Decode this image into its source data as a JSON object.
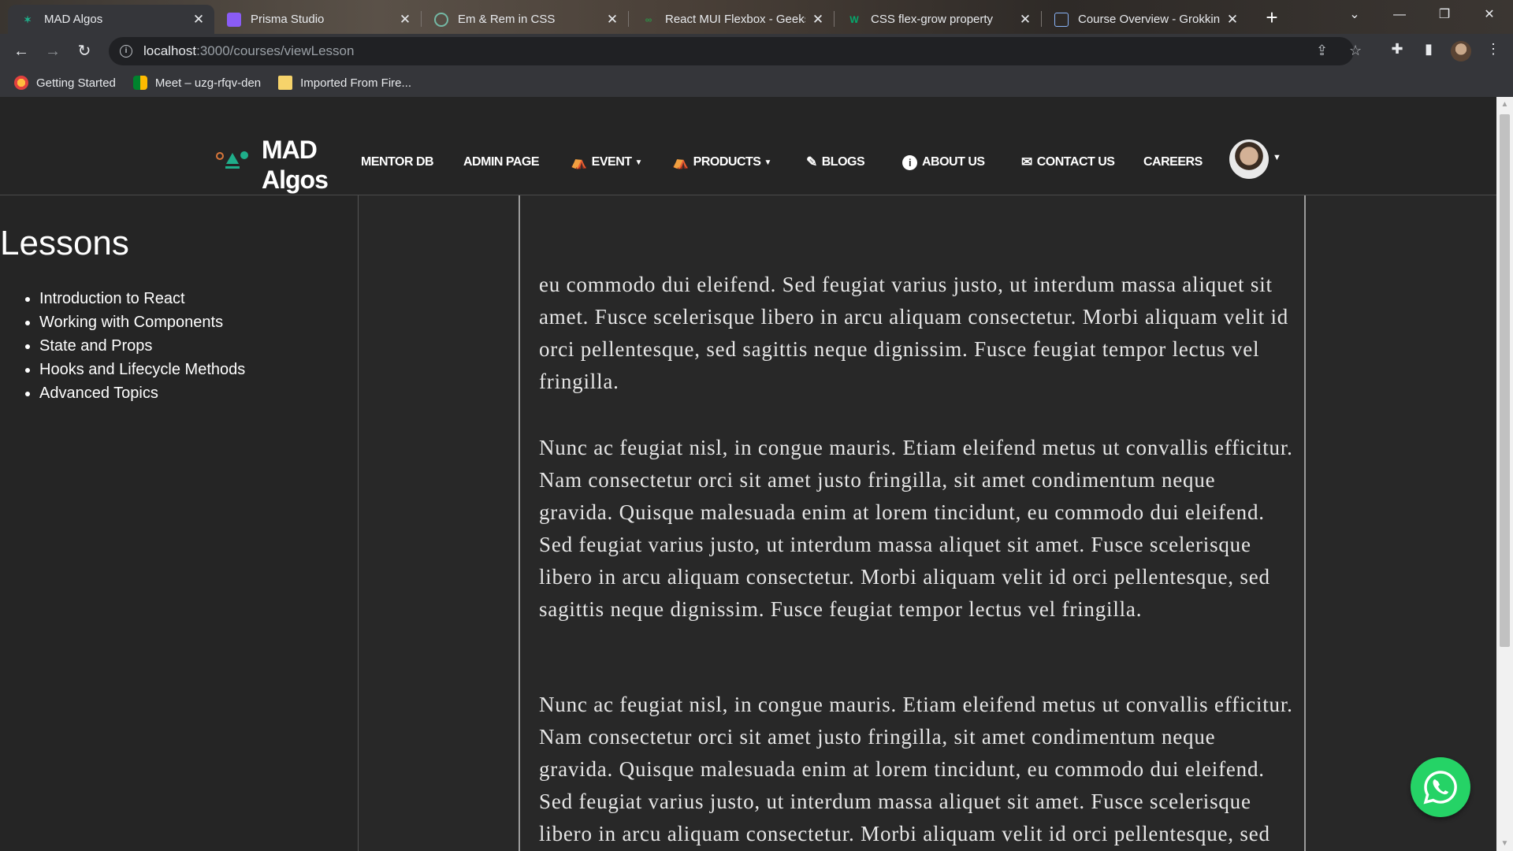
{
  "browser": {
    "tabs": [
      {
        "title": "MAD Algos",
        "active": true
      },
      {
        "title": "Prisma Studio",
        "active": false
      },
      {
        "title": "Em & Rem in CSS",
        "active": false
      },
      {
        "title": "React MUI Flexbox - Geeksf",
        "active": false
      },
      {
        "title": "CSS flex-grow property",
        "active": false
      },
      {
        "title": "Course Overview - Grokkinc",
        "active": false
      }
    ],
    "url_host": "localhost",
    "url_path": ":3000/courses/viewLesson",
    "bookmarks": [
      {
        "label": "Getting Started",
        "icon": "firefox-icon"
      },
      {
        "label": "Meet – uzg-rfqv-den",
        "icon": "meet-icon"
      },
      {
        "label": "Imported From Fire...",
        "icon": "folder-icon"
      }
    ]
  },
  "site": {
    "logo_line1": "MAD",
    "logo_line2": "Algos",
    "nav": [
      {
        "label": "MENTOR DB"
      },
      {
        "label": "ADMIN PAGE"
      },
      {
        "label": "EVENT",
        "icon": "event-icon",
        "dropdown": true
      },
      {
        "label": "PRODUCTS",
        "icon": "products-icon",
        "dropdown": true
      },
      {
        "label": "BLOGS",
        "icon": "edit-icon"
      },
      {
        "label": "ABOUT US",
        "icon": "info-icon"
      },
      {
        "label": "CONTACT US",
        "icon": "mail-icon"
      },
      {
        "label": "CAREERS"
      }
    ]
  },
  "sidebar": {
    "title": "Lessons",
    "lessons": [
      "Introduction to React",
      "Working with Components",
      "State and Props",
      "Hooks and Lifecycle Methods",
      "Advanced Topics"
    ]
  },
  "lesson": {
    "partial_paragraph": "eu commodo dui eleifend. Sed feugiat varius justo, ut interdum massa aliquet sit amet. Fusce scelerisque libero in arcu aliquam consectetur. Morbi aliquam velit id orci pellentesque, sed sagittis neque dignissim. Fusce feugiat tempor lectus vel fringilla.",
    "paragraphs": [
      "Nunc ac feugiat nisl, in congue mauris. Etiam eleifend metus ut convallis efficitur. Nam consectetur orci sit amet justo fringilla, sit amet condimentum neque gravida. Quisque malesuada enim at lorem tincidunt, eu commodo dui eleifend. Sed feugiat varius justo, ut interdum massa aliquet sit amet. Fusce scelerisque libero in arcu aliquam consectetur. Morbi aliquam velit id orci pellentesque, sed sagittis neque dignissim. Fusce feugiat tempor lectus vel fringilla.",
      "Nunc ac feugiat nisl, in congue mauris. Etiam eleifend metus ut convallis efficitur. Nam consectetur orci sit amet justo fringilla, sit amet condimentum neque gravida. Quisque malesuada enim at lorem tincidunt, eu commodo dui eleifend. Sed feugiat varius justo, ut interdum massa aliquet sit amet. Fusce scelerisque libero in arcu aliquam consectetur. Morbi aliquam velit id orci pellentesque, sed sagittis neque dignissim. Fusce feugiat tempor lectus vel fringilla."
    ]
  },
  "colors": {
    "page_bg": "#282828",
    "header_bg": "#252525",
    "whatsapp": "#25d366",
    "logo_accent": "#1fae8a"
  }
}
